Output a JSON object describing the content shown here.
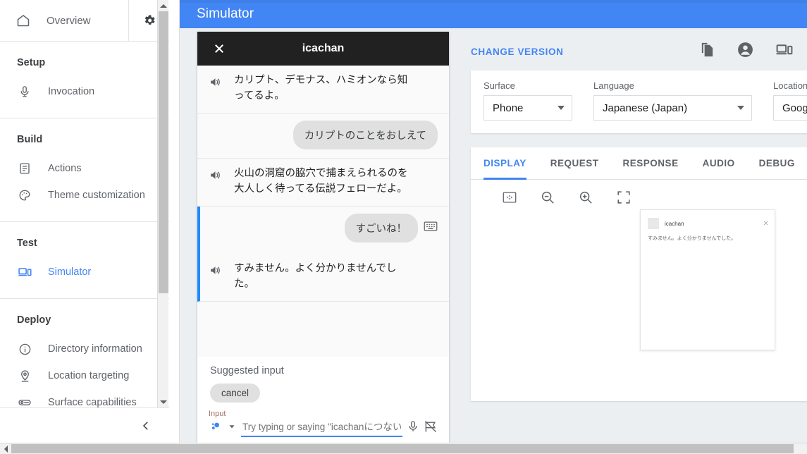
{
  "window": {
    "title": "Simulator"
  },
  "sidebar": {
    "overview": {
      "label": "Overview",
      "icon": "home-icon"
    },
    "settings_icon": "gear-icon",
    "groups": [
      {
        "title": "Setup",
        "items": [
          {
            "label": "Invocation",
            "icon": "microphone-icon",
            "active": false
          }
        ]
      },
      {
        "title": "Build",
        "items": [
          {
            "label": "Actions",
            "icon": "list-document-icon",
            "active": false
          },
          {
            "label": "Theme customization",
            "icon": "palette-icon",
            "active": false
          }
        ]
      },
      {
        "title": "Test",
        "items": [
          {
            "label": "Simulator",
            "icon": "devices-icon",
            "active": true
          }
        ]
      },
      {
        "title": "Deploy",
        "items": [
          {
            "label": "Directory information",
            "icon": "info-circle-icon",
            "active": false
          },
          {
            "label": "Location targeting",
            "icon": "map-pin-icon",
            "active": false
          },
          {
            "label": "Surface capabilities",
            "icon": "capsule-icon",
            "active": false
          }
        ]
      }
    ],
    "collapse_icon": "chevron-left-icon"
  },
  "simulator": {
    "phone_header": {
      "close_icon": "close-icon",
      "title": "icachan"
    },
    "conversation": [
      {
        "role": "agent",
        "speaker_icon": "speaker-icon",
        "text": "カリプト、デモナス、ハミオンなら知ってるよ。",
        "active": false
      },
      {
        "role": "user",
        "text": "カリプトのことをおしえて",
        "input_icon": null,
        "active": false
      },
      {
        "role": "agent",
        "speaker_icon": "speaker-icon",
        "text": "火山の洞窟の脇穴で捕まえられるのを大人しく待ってる伝説フェローだよ。",
        "active": false
      },
      {
        "role": "user",
        "text": "すごいね！",
        "input_icon": "keyboard-icon",
        "active": true
      },
      {
        "role": "agent",
        "speaker_icon": "speaker-icon",
        "text": "すみません。よく分かりませんでした。",
        "active": true
      }
    ],
    "suggested": {
      "label": "Suggested input",
      "chips": [
        "cancel"
      ]
    },
    "input": {
      "label": "Input",
      "value": "",
      "placeholder": "Try typing or saying \"icachanにつないで\"",
      "left_icon": "assistant-dots-icon",
      "caret_icon": "chevron-down-icon",
      "mic_icon": "microphone-icon",
      "mute_icon": "audio-off-icon"
    }
  },
  "right_panel": {
    "change_version_label": "CHANGE VERSION",
    "header_icons": [
      {
        "name": "copy-icon"
      },
      {
        "name": "account-circle-icon"
      },
      {
        "name": "devices-icon"
      }
    ],
    "config": [
      {
        "label": "Surface",
        "value": "Phone"
      },
      {
        "label": "Language",
        "value": "Japanese (Japan)"
      },
      {
        "label": "Location",
        "value": "Google"
      }
    ],
    "tabs": [
      {
        "label": "DISPLAY",
        "active": true
      },
      {
        "label": "REQUEST",
        "active": false
      },
      {
        "label": "RESPONSE",
        "active": false
      },
      {
        "label": "AUDIO",
        "active": false
      },
      {
        "label": "DEBUG",
        "active": false
      }
    ],
    "display_toolbar": [
      {
        "name": "fit-to-screen-icon"
      },
      {
        "name": "zoom-out-icon"
      },
      {
        "name": "zoom-in-icon"
      },
      {
        "name": "fullscreen-icon"
      }
    ],
    "preview_card": {
      "title": "icachan",
      "body": "すみません。よく分かりませんでした。",
      "close_icon": "close-icon"
    }
  },
  "colors": {
    "brand_blue": "#4285f4",
    "accent_blue": "#1a8cff",
    "panel_bg": "#eceff1",
    "phone_header": "#212121",
    "text_secondary": "#5f6368"
  }
}
